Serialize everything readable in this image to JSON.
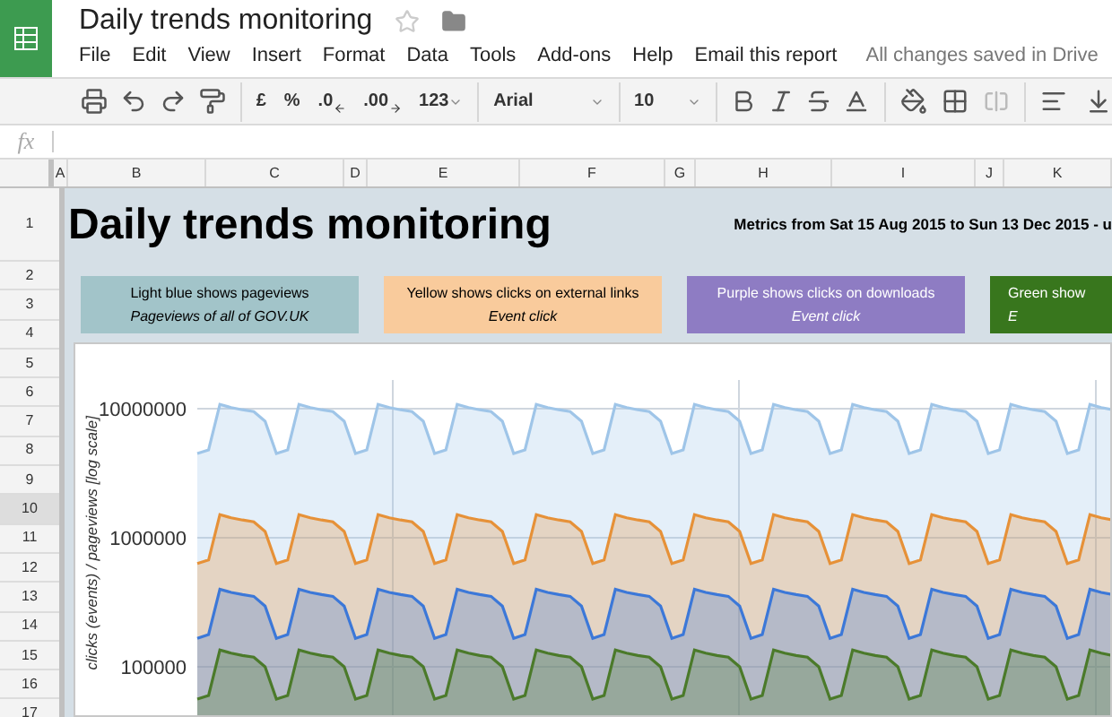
{
  "document": {
    "title": "Daily trends monitoring"
  },
  "menu": [
    "File",
    "Edit",
    "View",
    "Insert",
    "Format",
    "Data",
    "Tools",
    "Add-ons",
    "Help",
    "Email this report"
  ],
  "save_status": "All changes saved in Drive",
  "toolbar": {
    "currency": "£",
    "percent": "%",
    "decimal_decrease": ".0",
    "decimal_increase": ".00",
    "number_format": "123",
    "font": "Arial",
    "font_size": "10"
  },
  "formula_bar": {
    "label": "fx"
  },
  "columns": [
    "A",
    "B",
    "C",
    "D",
    "E",
    "F",
    "G",
    "H",
    "I",
    "J",
    "K"
  ],
  "row_headers": [
    {
      "label": "1",
      "selected": false
    },
    {
      "label": "2",
      "selected": false
    },
    {
      "label": "3",
      "selected": false
    },
    {
      "label": "4",
      "selected": false
    },
    {
      "label": "5",
      "selected": false
    },
    {
      "label": "6",
      "selected": false
    },
    {
      "label": "7",
      "selected": false
    },
    {
      "label": "8",
      "selected": false
    },
    {
      "label": "9",
      "selected": false
    },
    {
      "label": "10",
      "selected": true
    },
    {
      "label": "11",
      "selected": false
    },
    {
      "label": "12",
      "selected": false
    },
    {
      "label": "13",
      "selected": false
    },
    {
      "label": "14",
      "selected": false
    },
    {
      "label": "15",
      "selected": false
    },
    {
      "label": "16",
      "selected": false
    },
    {
      "label": "17",
      "selected": false
    }
  ],
  "sheet": {
    "title": "Daily trends monitoring",
    "metrics": "Metrics from Sat 15 Aug 2015 to Sun 13 Dec 2015 - u",
    "legend": [
      {
        "label": "Light blue shows pageviews",
        "sublabel": "Pageviews of all of GOV.UK",
        "color": "#a2c4c9"
      },
      {
        "label": "Yellow shows clicks on external links",
        "sublabel": "Event click",
        "color": "#f9cb9c"
      },
      {
        "label": "Purple shows clicks on downloads",
        "sublabel": "Event click",
        "color": "#8e7cc3"
      },
      {
        "label": "Green show",
        "sublabel": "E",
        "color": "#38761d"
      }
    ],
    "chart": {
      "axis_title": "clicks (events) / pageviews [log scale]",
      "axis_labels": [
        "10000000",
        "1000000",
        "100000"
      ],
      "series": [
        {
          "color": "#9fc5e8"
        },
        {
          "color": "#e69138"
        },
        {
          "color": "#3c78d8"
        },
        {
          "color": "#4b7a2a"
        }
      ]
    }
  }
}
